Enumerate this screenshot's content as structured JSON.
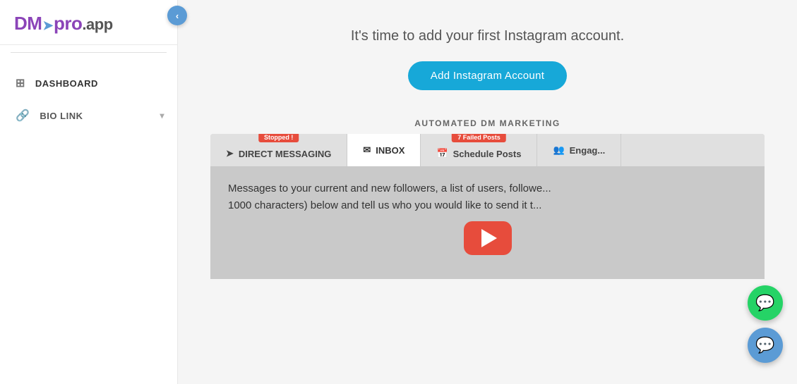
{
  "brand": {
    "name_part1": "DM",
    "name_part2": "pro",
    "name_part3": ".app",
    "logo_arrow": "➤"
  },
  "sidebar": {
    "collapse_icon": "‹",
    "items": [
      {
        "id": "dashboard",
        "label": "DASHBOARD",
        "icon": "⊞"
      },
      {
        "id": "bio-link",
        "label": "BIO LINK",
        "icon": "🔗",
        "has_arrow": true
      }
    ]
  },
  "main": {
    "headline": "It's time to add your first Instagram account.",
    "add_button_label": "Add Instagram Account",
    "dm_section_label": "AUTOMATED DM MARKETING",
    "tabs": [
      {
        "id": "direct-messaging",
        "label": "DIRECT MESSAGING",
        "icon": "➤",
        "badge": "Stopped !",
        "active": false
      },
      {
        "id": "inbox",
        "label": "INBOX",
        "icon": "✉",
        "badge": null,
        "active": true
      },
      {
        "id": "schedule-posts",
        "label": "Schedule Posts",
        "icon": "📅",
        "badge": "7 Failed Posts",
        "active": false
      },
      {
        "id": "engage",
        "label": "Engag...",
        "icon": "👥",
        "badge": null,
        "active": false
      }
    ],
    "preview_text_line1": "Messages to your current and new followers, a list of users, followe...",
    "preview_text_line2": "1000 characters) below and tell us who you would like to send it t...",
    "play_button_label": "Play video"
  },
  "colors": {
    "accent_blue": "#17a8d8",
    "brand_purple": "#8b44b8",
    "badge_red": "#e74c3c",
    "sidebar_bg": "#ffffff",
    "main_bg": "#f5f5f5",
    "whatsapp_green": "#25d366",
    "chat_blue": "#5b9bd5",
    "collapse_blue": "#5b9bd5"
  }
}
